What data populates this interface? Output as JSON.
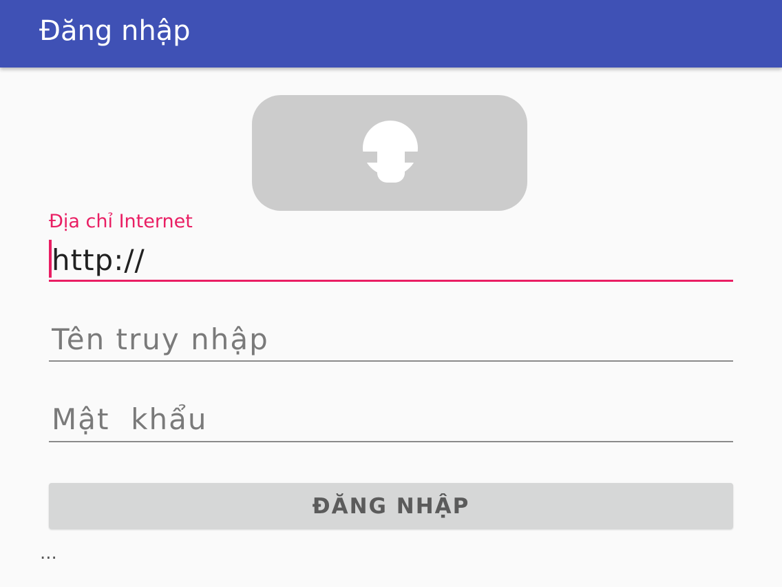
{
  "app_bar": {
    "title": "Đăng nhập",
    "color": "#3f51b5"
  },
  "logo": {
    "icon": "keyhole-lock-icon"
  },
  "form": {
    "url_field": {
      "label": "Địa chỉ Internet",
      "value": "http://",
      "focused": true
    },
    "username_field": {
      "placeholder": "Tên truy nhập",
      "value": ""
    },
    "password_field": {
      "placeholder": "Mật  khẩu",
      "value": ""
    },
    "login_button": {
      "label": "ĐĂNG NHẬP"
    }
  },
  "status": {
    "text": "..."
  },
  "colors": {
    "accent": "#e91e63",
    "primary": "#3f51b5",
    "button": "#d6d7d7"
  }
}
